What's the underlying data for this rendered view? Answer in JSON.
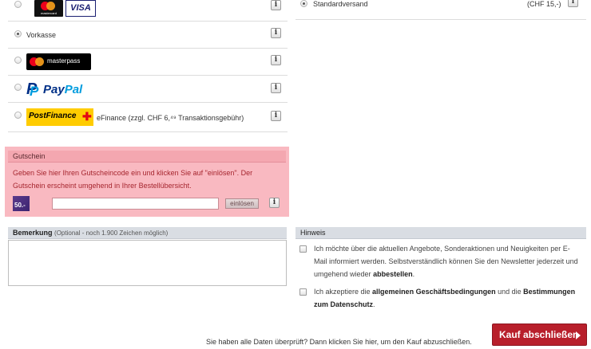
{
  "payment": {
    "cards_logo": {
      "mastercard_text": "mastercard",
      "visa_text": "VISA"
    },
    "vorkasse_label": "Vorkasse",
    "masterpass_text": "masterpass",
    "paypal_text_a": "Pay",
    "paypal_text_b": "Pal",
    "postfinance_text": "PostFinance",
    "efinance_label": "eFinance (zzgl. CHF 6,⁴⁹ Transaktionsgebühr)",
    "info_glyph": "i",
    "selected": "Vorkasse"
  },
  "shipping": {
    "label": "Standardversand",
    "price": "(CHF 15,-)",
    "selected": true
  },
  "voucher": {
    "title": "Gutschein",
    "description": "Geben Sie hier Ihren Gutscheincode ein und klicken Sie auf \"einlösen\". Der Gutschein erscheint umgehend in Ihrer Bestellübersicht.",
    "image_text": "50.-",
    "code_value": "",
    "redeem_label": "einlösen"
  },
  "remark": {
    "title": "Bemerkung",
    "hint": "(Optional - noch 1.900 Zeichen möglich)",
    "value": ""
  },
  "hint_section": {
    "title": "Hinweis",
    "newsletter_text_a": "Ich möchte über die aktuellen Angebote, Sonderaktionen und Neuigkeiten per E-Mail informiert werden. Selbstverständlich können Sie den Newsletter jederzeit und umgehend wieder ",
    "newsletter_link": "abbestellen",
    "newsletter_text_b": ".",
    "terms_text_a": "Ich akzeptiere die ",
    "terms_link_agb": "allgemeinen Geschäftsbedingungen",
    "terms_text_b": " und die ",
    "terms_link_privacy": "Bestimmungen zum Datenschutz",
    "terms_text_c": "."
  },
  "footer": {
    "text": "Sie haben alle Daten überprüft? Dann klicken Sie hier, um den Kauf abzuschließen.",
    "buy_label": "Kauf abschließen"
  },
  "colors": {
    "voucher_bg": "#f9b9c1",
    "voucher_text": "#a6262f",
    "buy_button": "#b81f2b",
    "section_header": "#d9dde3"
  }
}
